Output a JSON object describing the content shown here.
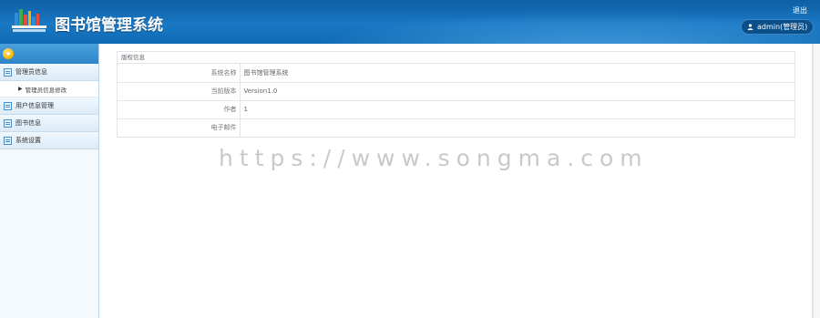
{
  "header": {
    "app_title": "图书馆管理系统",
    "logout_label": "退出",
    "user_label": "admin(管理员)"
  },
  "sidebar": {
    "groups": [
      {
        "label": "管理员信息",
        "sub": [
          {
            "label": "管理员信息修改"
          }
        ]
      },
      {
        "label": "用户信息管理"
      },
      {
        "label": "图书信息"
      },
      {
        "label": "系统设置"
      }
    ]
  },
  "panel": {
    "title": "版权信息",
    "rows": [
      {
        "label": "系统名称",
        "value": "图书馆管理系统"
      },
      {
        "label": "当前版本",
        "value": "Version1.0"
      },
      {
        "label": "作者",
        "value": "1"
      },
      {
        "label": "电子邮件",
        "value": ""
      }
    ]
  },
  "watermark": "https://www.songma.com",
  "colors": {
    "header": "#1a78c4",
    "sidebar_bg": "#f4f9fd",
    "toggle": "#f2b400"
  }
}
